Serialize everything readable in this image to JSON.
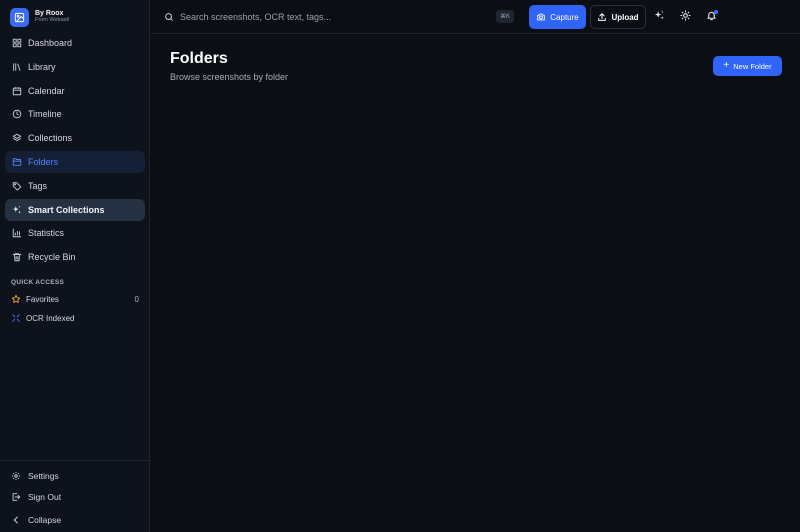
{
  "brand": {
    "name": "By Roox",
    "subtitle": "From Webaall"
  },
  "sidebar": {
    "items": [
      {
        "label": "Dashboard",
        "icon": "dashboard-icon"
      },
      {
        "label": "Library",
        "icon": "library-icon"
      },
      {
        "label": "Calendar",
        "icon": "calendar-icon"
      },
      {
        "label": "Timeline",
        "icon": "clock-icon"
      },
      {
        "label": "Collections",
        "icon": "layers-icon"
      },
      {
        "label": "Folders",
        "icon": "folder-icon",
        "active": true
      },
      {
        "label": "Tags",
        "icon": "tag-icon"
      },
      {
        "label": "Smart Collections",
        "icon": "sparkles-icon",
        "hovered": true
      },
      {
        "label": "Statistics",
        "icon": "bar-chart-icon"
      },
      {
        "label": "Recycle Bin",
        "icon": "trash-icon"
      }
    ],
    "quick_access": {
      "title": "QUICK ACCESS",
      "items": [
        {
          "label": "Favorites",
          "icon": "star-icon",
          "count": "0"
        },
        {
          "label": "OCR Indexed",
          "icon": "scan-icon"
        }
      ]
    },
    "bottom": {
      "settings": "Settings",
      "sign_out": "Sign Out",
      "collapse": "Collapse"
    }
  },
  "topbar": {
    "search_placeholder": "Search screenshots, OCR text, tags...",
    "shortcut": "⌘K",
    "capture_label": "Capture",
    "upload_label": "Upload"
  },
  "main": {
    "title": "Folders",
    "subtitle": "Browse screenshots by folder",
    "new_folder_label": "New Folder"
  },
  "colors": {
    "accent": "#2f64f6",
    "active_bg": "#152036",
    "active_text": "#4f86ff",
    "background": "#0b0e14",
    "sidebar_bg": "#0e121a",
    "star": "#f0a23b"
  }
}
